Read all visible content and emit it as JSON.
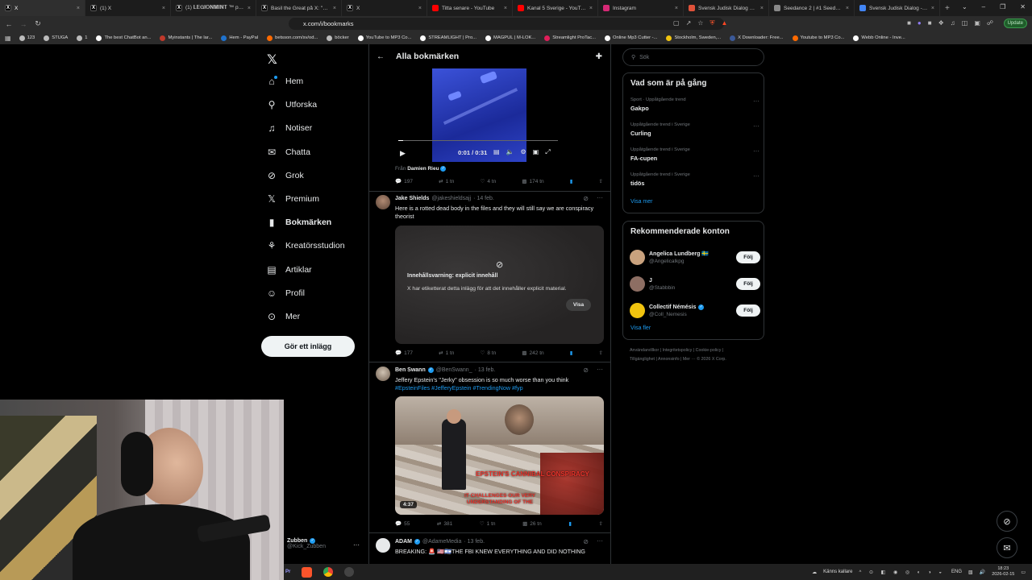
{
  "browser": {
    "tabs": [
      {
        "title": "X",
        "icon": "x-logo",
        "color": "#000000",
        "active": true
      },
      {
        "title": "(1) X",
        "icon": "x-logo",
        "color": "#000000"
      },
      {
        "title": "(1) 𝐋𝐄𝐆𝐈𝐎𝐍𝐌𝐈𝐍𝐓 ™ på X: \"Det",
        "icon": "x-logo",
        "color": "#000000"
      },
      {
        "title": "Basil the Great på X: \"a This is",
        "icon": "x-logo",
        "color": "#000000"
      },
      {
        "title": "X",
        "icon": "x-logo",
        "color": "#000000"
      },
      {
        "title": "Titta senare - YouTube",
        "icon": "youtube-icon",
        "color": "#ff0000"
      },
      {
        "title": "Kanal 5 Sverige - YouTube",
        "icon": "youtube-icon",
        "color": "#ff0000"
      },
      {
        "title": "Instagram",
        "icon": "instagram-icon",
        "color": "#d62976"
      },
      {
        "title": "Svensk Judisk Dialog kampanj",
        "icon": "site-icon",
        "color": "#e0523a"
      },
      {
        "title": "Seedance 2 | #1 Seedance 2 AI",
        "icon": "site-icon",
        "color": "#888888"
      },
      {
        "title": "Svensk Judisk Dialog - Google",
        "icon": "google-icon",
        "color": "#4285f4"
      }
    ],
    "new_tab": "+",
    "url": "x.com/i/bookmarks",
    "update_label": "Update",
    "bookmarks": [
      {
        "label": "123",
        "color": "#bbbbbb"
      },
      {
        "label": "STUGA",
        "color": "#bbbbbb"
      },
      {
        "label": "1",
        "color": "#bbbbbb"
      },
      {
        "label": "The best ChatBot an...",
        "color": "#ffffff"
      },
      {
        "label": "Myinstants | The lar...",
        "color": "#c0392b"
      },
      {
        "label": "Hem - PayPal",
        "color": "#1f72cd"
      },
      {
        "label": "betsson.com/sv/od...",
        "color": "#ff6a00"
      },
      {
        "label": "böcker",
        "color": "#bbbbbb"
      },
      {
        "label": "YouTube to MP3 Co...",
        "color": "#ffffff"
      },
      {
        "label": "STREAMLIGHT | Pro...",
        "color": "#ffffff"
      },
      {
        "label": "MAGPUL | M-LOK...",
        "color": "#ffffff"
      },
      {
        "label": "Streamlight ProTac...",
        "color": "#e01e5a"
      },
      {
        "label": "Online Mp3 Cutter -...",
        "color": "#ffffff"
      },
      {
        "label": "Stockholm, Sweden,...",
        "color": "#f1c40f"
      },
      {
        "label": "X Downloader: Free...",
        "color": "#3b5998"
      },
      {
        "label": "Youtube to MP3 Co...",
        "color": "#ff6a00"
      },
      {
        "label": "Webb Online - Inve...",
        "color": "#ffffff"
      }
    ]
  },
  "x_nav": {
    "items": [
      {
        "label": "Hem",
        "icon": "home-icon"
      },
      {
        "label": "Utforska",
        "icon": "search-icon"
      },
      {
        "label": "Notiser",
        "icon": "bell-icon"
      },
      {
        "label": "Chatta",
        "icon": "mail-icon"
      },
      {
        "label": "Grok",
        "icon": "grok-icon"
      },
      {
        "label": "Premium",
        "icon": "x-logo"
      },
      {
        "label": "Bokmärken",
        "icon": "bookmark-icon",
        "active": true
      },
      {
        "label": "Kreatörsstudion",
        "icon": "creator-icon"
      },
      {
        "label": "Artiklar",
        "icon": "article-icon"
      },
      {
        "label": "Profil",
        "icon": "profile-icon"
      },
      {
        "label": "Mer",
        "icon": "more-icon"
      }
    ],
    "post_button": "Gör ett inlägg",
    "account": {
      "name": "Zubben",
      "handle": "@Kick_Zubben"
    }
  },
  "timeline": {
    "title": "Alla bokmärken",
    "video1": {
      "time": "0:01 / 0:31",
      "from_label": "Från",
      "from_user": "Damien Rieu",
      "replies": "197",
      "reposts": "1 tn",
      "likes": "4 tn",
      "views": "174 tn"
    },
    "tweets": [
      {
        "name": "Jake Shields",
        "handle": "@jakeshieldsajj",
        "date": "· 14 feb.",
        "text": "Here is a rotted dead body in the files and they will still say we are conspiracy theorist",
        "warning_title": "Innehållsvarning: explicit innehåll",
        "warning_text": "X har etiketterat detta inlägg för att det innehåller explicit material.",
        "show_label": "Visa",
        "replies": "177",
        "reposts": "1 tn",
        "likes": "8 tn",
        "views": "242 tn"
      },
      {
        "name": "Ben Swann",
        "handle": "@BenSwann_",
        "date": "· 13 feb.",
        "text": "Jeffery Epstein's \"Jerky\" obsession is so much worse than you think",
        "hashtags": "#EpsteinFiles #JefferyEpstein #TrendingNow #fyp",
        "video_duration": "4:37",
        "overlay_title": "EPSTEIN'S CANNIBAL CONSPIRACY",
        "overlay_caption": "IT CHALLENGES OUR VERY UNDERSTANDING OF THE",
        "replies": "55",
        "reposts": "381",
        "likes": "1 tn",
        "views": "26 tn"
      },
      {
        "name": "ADAM",
        "handle": "@AdameMedia",
        "date": "· 13 feb.",
        "text": "BREAKING: 🚨 🇺🇸🇮🇱THE FBI KNEW EVERYTHING AND DID NOTHING"
      }
    ]
  },
  "right": {
    "search_placeholder": "Sök",
    "trends_title": "Vad som är på gång",
    "trends": [
      {
        "context": "Sport · Uppåtgående trend",
        "name": "Gakpo"
      },
      {
        "context": "Uppåtgående trend i Sverige",
        "name": "Curling"
      },
      {
        "context": "Uppåtgående trend i Sverige",
        "name": "FA-cupen"
      },
      {
        "context": "Uppåtgående trend i Sverige",
        "name": "tidös"
      }
    ],
    "show_more": "Visa mer",
    "recommend_title": "Rekommenderade konton",
    "accounts": [
      {
        "name": "Angelica Lundberg 🇸🇪",
        "handle": "@Angelicalkpg",
        "follow": "Följ",
        "color": "#c9a27e"
      },
      {
        "name": "J",
        "handle": "@Stabbbin",
        "follow": "Följ",
        "color": "#8d6e63"
      },
      {
        "name": "Collectif Némésis",
        "handle": "@Coll_Nemesis",
        "follow": "Följ",
        "color": "#f1c40f"
      }
    ],
    "show_more2": "Visa fler",
    "footer_lines": [
      "Användarvillkor  |  Integritetspolicy  |  Cookie-policy  |",
      "Tillgänglighet  |  Annonsinfo  |  Mer ···  © 2026 X Corp."
    ]
  },
  "taskbar": {
    "weather": "Känns kallare",
    "lang": "ENG",
    "time": "18:23",
    "date": "2026-02-15"
  }
}
